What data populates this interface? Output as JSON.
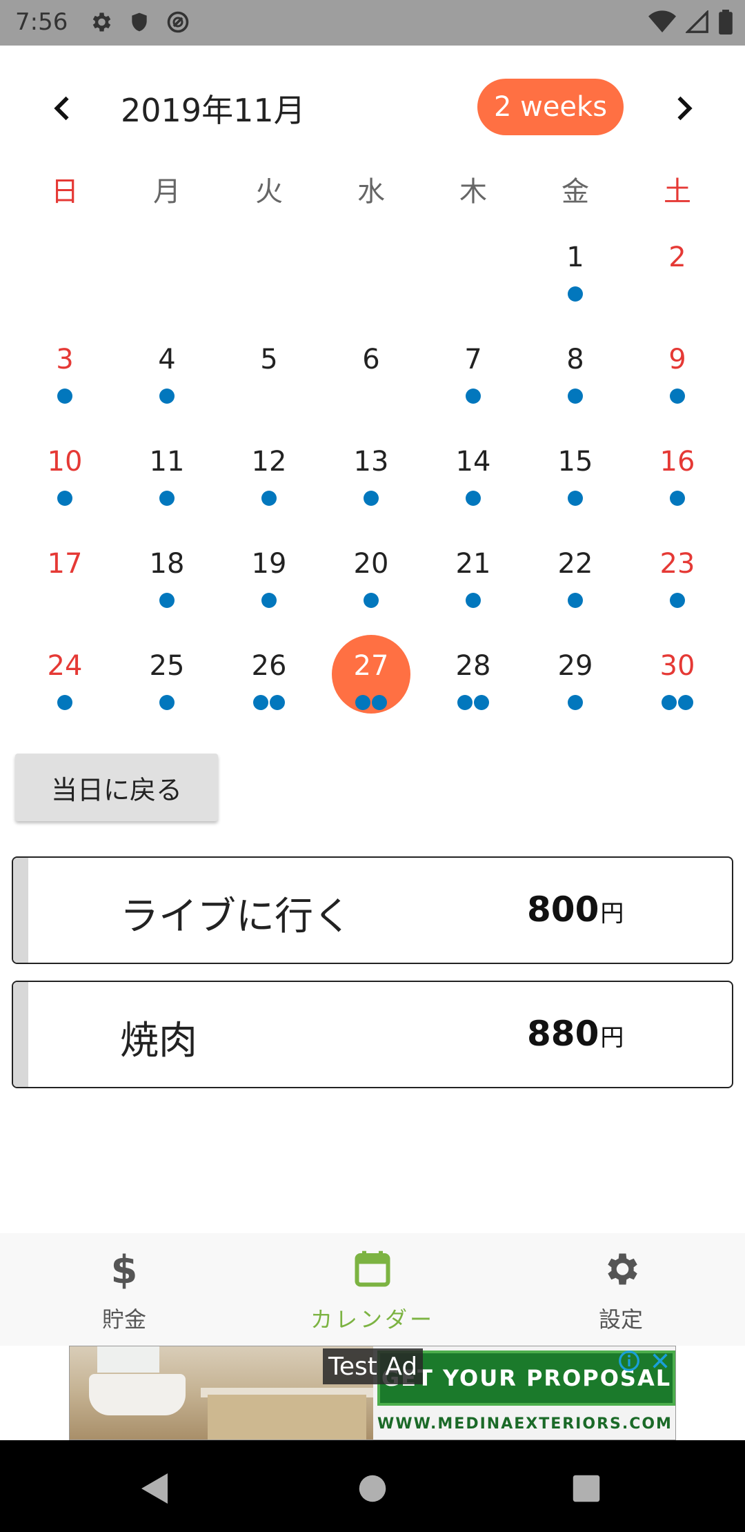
{
  "status_bar": {
    "time": "7:56",
    "left_icons": [
      "gear-icon",
      "shield-icon",
      "sync-off-icon"
    ],
    "right_icons": [
      "wifi-icon",
      "cell-signal-icon",
      "battery-icon"
    ]
  },
  "calendar": {
    "month_title": "2019年11月",
    "format_button": "2 weeks",
    "weekdays": [
      "日",
      "月",
      "火",
      "水",
      "木",
      "金",
      "土"
    ],
    "selected_day": "27",
    "accent_color": "#ff7043",
    "dot_color": "#0277bd",
    "days": [
      {
        "d": "1",
        "dots": 1
      },
      {
        "d": "2",
        "dots": 0
      },
      {
        "d": "3",
        "dots": 1
      },
      {
        "d": "4",
        "dots": 1
      },
      {
        "d": "5",
        "dots": 0
      },
      {
        "d": "6",
        "dots": 0
      },
      {
        "d": "7",
        "dots": 1
      },
      {
        "d": "8",
        "dots": 1
      },
      {
        "d": "9",
        "dots": 1
      },
      {
        "d": "10",
        "dots": 1
      },
      {
        "d": "11",
        "dots": 1
      },
      {
        "d": "12",
        "dots": 1
      },
      {
        "d": "13",
        "dots": 1
      },
      {
        "d": "14",
        "dots": 1
      },
      {
        "d": "15",
        "dots": 1
      },
      {
        "d": "16",
        "dots": 1
      },
      {
        "d": "17",
        "dots": 0
      },
      {
        "d": "18",
        "dots": 1
      },
      {
        "d": "19",
        "dots": 1
      },
      {
        "d": "20",
        "dots": 1
      },
      {
        "d": "21",
        "dots": 1
      },
      {
        "d": "22",
        "dots": 1
      },
      {
        "d": "23",
        "dots": 1
      },
      {
        "d": "24",
        "dots": 1
      },
      {
        "d": "25",
        "dots": 1
      },
      {
        "d": "26",
        "dots": 2
      },
      {
        "d": "27",
        "dots": 2
      },
      {
        "d": "28",
        "dots": 2
      },
      {
        "d": "29",
        "dots": 1
      },
      {
        "d": "30",
        "dots": 2
      }
    ]
  },
  "today_button": "当日に戻る",
  "events": [
    {
      "title": "ライブに行く",
      "amount": "800",
      "unit": "円"
    },
    {
      "title": "焼肉",
      "amount": "880",
      "unit": "円"
    }
  ],
  "bottom_nav": {
    "items": [
      {
        "label": "貯金",
        "icon": "dollar-icon"
      },
      {
        "label": "カレンダー",
        "icon": "calendar-icon"
      },
      {
        "label": "設定",
        "icon": "gear-icon"
      }
    ],
    "active_color": "#7cb342"
  },
  "ad": {
    "label": "Test Ad",
    "cta": "GET YOUR PROPOSAL",
    "url": "WWW.MEDINAEXTERIORS.COM"
  }
}
